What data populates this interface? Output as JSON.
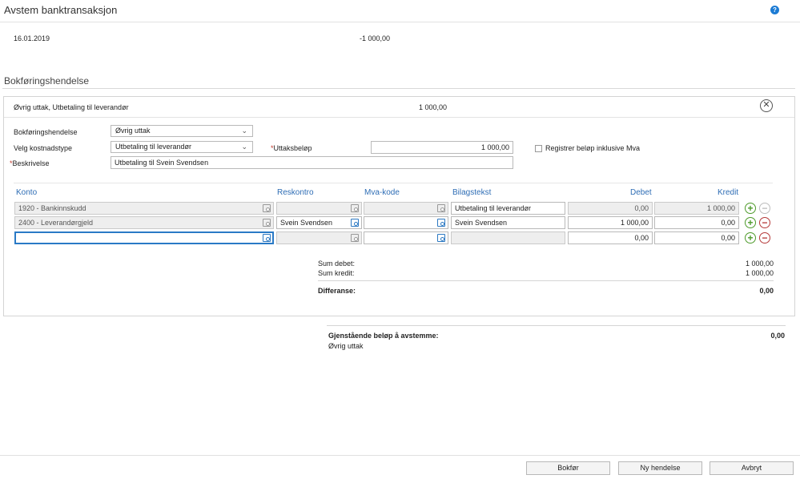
{
  "window": {
    "title": "Avstem banktransaksjon",
    "help_icon": "?"
  },
  "transaction": {
    "date": "16.01.2019",
    "amount": "-1 000,00"
  },
  "section": {
    "title": "Bokføringshendelse"
  },
  "event": {
    "header_text": "Øvrig uttak, Utbetaling til leverandør",
    "header_amount": "1 000,00",
    "close_glyph": "✕",
    "labels": {
      "bokforingshendelse": "Bokføringshendelse",
      "kostnadstype": "Velg kostnadstype",
      "uttaksbelop": "Uttaksbeløp",
      "beskrivelse": "Beskrivelse",
      "required_mark": "*",
      "mva_checkbox": "Registrer beløp inklusive Mva"
    },
    "values": {
      "bokforingshendelse": "Øvrig uttak",
      "kostnadstype": "Utbetaling til leverandør",
      "uttaksbelop": "1 000,00",
      "beskrivelse": "Utbetaling til Svein Svendsen"
    }
  },
  "table": {
    "columns": {
      "konto": "Konto",
      "reskontro": "Reskontro",
      "mva_kode": "Mva-kode",
      "bilagstekst": "Bilagstekst",
      "debet": "Debet",
      "kredit": "Kredit"
    },
    "rows": [
      {
        "konto": "1920 - Bankinnskudd",
        "reskontro": "",
        "mva_kode": "",
        "bilagstekst": "Utbetaling til leverandør",
        "debet": "0,00",
        "kredit": "1 000,00"
      },
      {
        "konto": "2400 - Leverandørgjeld",
        "reskontro": "Svein Svendsen",
        "mva_kode": "",
        "bilagstekst": "Svein Svendsen",
        "debet": "1 000,00",
        "kredit": "0,00"
      },
      {
        "konto": "",
        "reskontro": "",
        "mva_kode": "",
        "bilagstekst": "",
        "debet": "0,00",
        "kredit": "0,00"
      }
    ],
    "add_glyph": "+",
    "remove_glyph": "−"
  },
  "sums": {
    "debet_label": "Sum debet:",
    "debet_value": "1 000,00",
    "kredit_label": "Sum kredit:",
    "kredit_value": "1 000,00",
    "diff_label": "Differanse:",
    "diff_value": "0,00"
  },
  "remaining": {
    "label": "Gjenstående beløp å avstemme:",
    "value": "0,00",
    "sub": "Øvrig uttak"
  },
  "footer": {
    "bokfor": "Bokfør",
    "ny_hendelse": "Ny hendelse",
    "avbryt": "Avbryt"
  },
  "colors": {
    "accent": "#2e6db5",
    "add": "#4d9a2a",
    "remove": "#b53a3a"
  }
}
